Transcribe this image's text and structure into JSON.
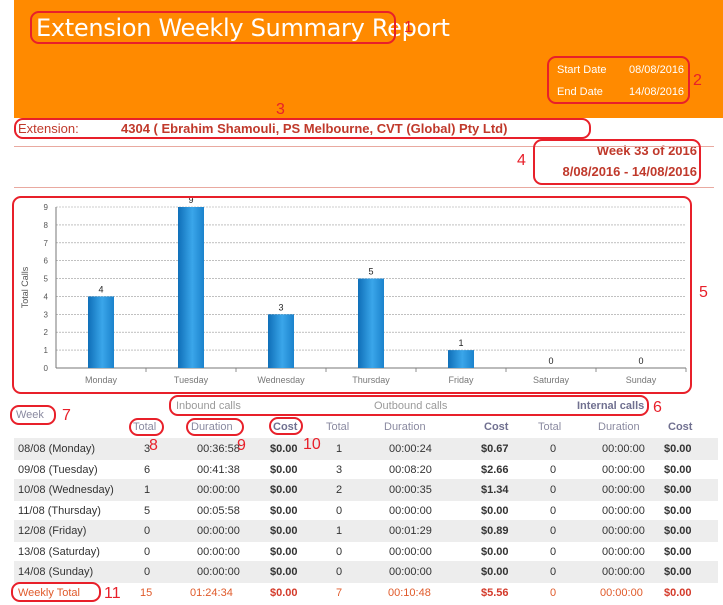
{
  "header": {
    "title": "Extension Weekly Summary Report",
    "start_date_label": "Start Date",
    "start_date": "08/08/2016",
    "end_date_label": "End Date",
    "end_date": "14/08/2016"
  },
  "extension": {
    "label": "Extension:",
    "value": "4304 ( Ebrahim Shamouli,  PS Melbourne,  CVT (Global) Pty Ltd)"
  },
  "week": {
    "title": "Week 33 of 2016",
    "range": "8/08/2016 - 14/08/2016"
  },
  "annotations": [
    "1",
    "2",
    "3",
    "4",
    "5",
    "6",
    "7",
    "8",
    "9",
    "10",
    "11"
  ],
  "colors": {
    "header": "#ff8a00",
    "accent": "#c0392b",
    "bar": "#1f8fd6",
    "annotation": "#e8202a"
  },
  "chart_data": {
    "type": "bar",
    "ylabel": "Total Calls",
    "categories": [
      "Monday",
      "Tuesday",
      "Wednesday",
      "Thursday",
      "Friday",
      "Saturday",
      "Sunday"
    ],
    "values": [
      4,
      9,
      3,
      5,
      1,
      0,
      0
    ],
    "ylim": [
      0,
      9
    ],
    "yticks": [
      "0",
      "1",
      "2",
      "3",
      "4",
      "5",
      "6",
      "7",
      "8",
      "9"
    ],
    "grid": true
  },
  "table": {
    "groups": {
      "inbound": "Inbound calls",
      "outbound": "Outbound calls",
      "internal": "Internal calls"
    },
    "week_header": "Week",
    "col_total": "Total",
    "col_duration": "Duration",
    "col_cost": "Cost",
    "rows": [
      {
        "week": "08/08 (Monday)",
        "in_total": "3",
        "in_dur": "00:36:58",
        "in_cost": "$0.00",
        "out_total": "1",
        "out_dur": "00:00:24",
        "out_cost": "$0.67",
        "int_total": "0",
        "int_dur": "00:00:00",
        "int_cost": "$0.00"
      },
      {
        "week": "09/08 (Tuesday)",
        "in_total": "6",
        "in_dur": "00:41:38",
        "in_cost": "$0.00",
        "out_total": "3",
        "out_dur": "00:08:20",
        "out_cost": "$2.66",
        "int_total": "0",
        "int_dur": "00:00:00",
        "int_cost": "$0.00"
      },
      {
        "week": "10/08 (Wednesday)",
        "in_total": "1",
        "in_dur": "00:00:00",
        "in_cost": "$0.00",
        "out_total": "2",
        "out_dur": "00:00:35",
        "out_cost": "$1.34",
        "int_total": "0",
        "int_dur": "00:00:00",
        "int_cost": "$0.00"
      },
      {
        "week": "11/08 (Thursday)",
        "in_total": "5",
        "in_dur": "00:05:58",
        "in_cost": "$0.00",
        "out_total": "0",
        "out_dur": "00:00:00",
        "out_cost": "$0.00",
        "int_total": "0",
        "int_dur": "00:00:00",
        "int_cost": "$0.00"
      },
      {
        "week": "12/08 (Friday)",
        "in_total": "0",
        "in_dur": "00:00:00",
        "in_cost": "$0.00",
        "out_total": "1",
        "out_dur": "00:01:29",
        "out_cost": "$0.89",
        "int_total": "0",
        "int_dur": "00:00:00",
        "int_cost": "$0.00"
      },
      {
        "week": "13/08 (Saturday)",
        "in_total": "0",
        "in_dur": "00:00:00",
        "in_cost": "$0.00",
        "out_total": "0",
        "out_dur": "00:00:00",
        "out_cost": "$0.00",
        "int_total": "0",
        "int_dur": "00:00:00",
        "int_cost": "$0.00"
      },
      {
        "week": "14/08 (Sunday)",
        "in_total": "0",
        "in_dur": "00:00:00",
        "in_cost": "$0.00",
        "out_total": "0",
        "out_dur": "00:00:00",
        "out_cost": "$0.00",
        "int_total": "0",
        "int_dur": "00:00:00",
        "int_cost": "$0.00"
      }
    ],
    "total_row": {
      "week": "Weekly Total",
      "in_total": "15",
      "in_dur": "01:24:34",
      "in_cost": "$0.00",
      "out_total": "7",
      "out_dur": "00:10:48",
      "out_cost": "$5.56",
      "int_total": "0",
      "int_dur": "00:00:00",
      "int_cost": "$0.00"
    }
  }
}
